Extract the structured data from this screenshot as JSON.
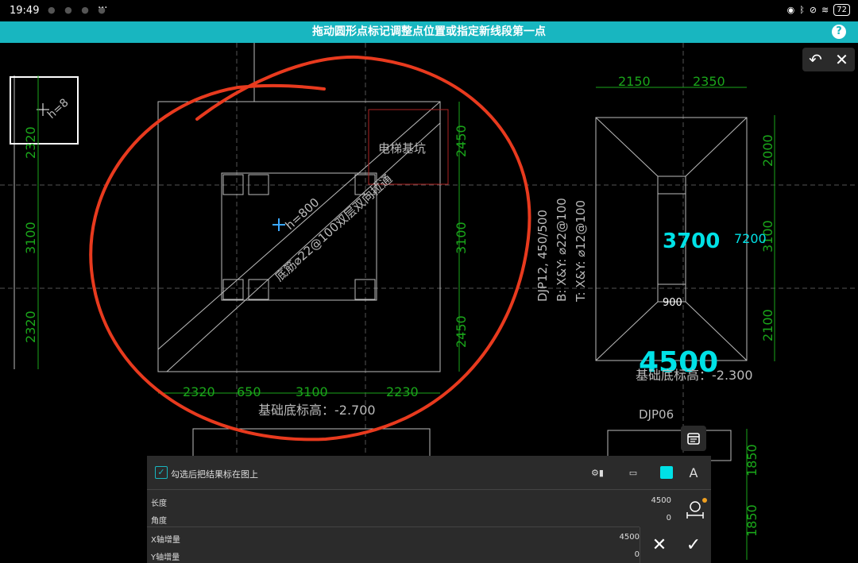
{
  "status_bar": {
    "time": "19:49",
    "more": "···",
    "battery": "72"
  },
  "top_bar": {
    "title": "拖动圆形点标记调整点位置或指定新线段第一点",
    "help_glyph": "?"
  },
  "cad": {
    "dims_left": [
      "2320",
      "3100",
      "2320"
    ],
    "dims_mid_right": [
      "2450",
      "3100",
      "2450"
    ],
    "dims_bottom": [
      "2320",
      "650",
      "3100",
      "2230"
    ],
    "elevation_left": "基础底标高：-2.700",
    "elevator_pit": "电梯基坑",
    "rebar_text": "底筋⌀22@100双层双向拉通",
    "h_label": "h=800",
    "h_label2": "h=8",
    "djp_lines": [
      "DJP12, 450/500",
      "B: X&Y: ⌀22@100",
      "T: X&Y: ⌀12@100"
    ],
    "dims_top_right": [
      "2150",
      "2350"
    ],
    "dims_right": [
      "2000",
      "3100",
      "2100"
    ],
    "big_num_3700": "3700",
    "num_7200": "7200",
    "num_900": "900",
    "big_num_4500": "4500",
    "elevation_right": "基础底标高：-2.300",
    "djp06": "DJP06",
    "dims_far_right": [
      "1850",
      "1850"
    ]
  },
  "toolbar": {
    "undo": "↶",
    "close": "✕"
  },
  "panel": {
    "checkbox_label": "勾选后把结果标在图上",
    "checkbox_mark": "✓",
    "text_tool": "A",
    "fields": [
      {
        "label": "长度",
        "value": "4500"
      },
      {
        "label": "角度",
        "value": "0"
      },
      {
        "label": "X轴增量",
        "value": "4500"
      },
      {
        "label": "Y轴增量",
        "value": "0"
      }
    ],
    "cancel": "✕",
    "confirm": "✓"
  },
  "colors": {
    "accent": "#18b6c0",
    "cyan_text": "#00e1e6",
    "green_dim": "#1aa61a",
    "annotation_red": "#e83a1e"
  }
}
